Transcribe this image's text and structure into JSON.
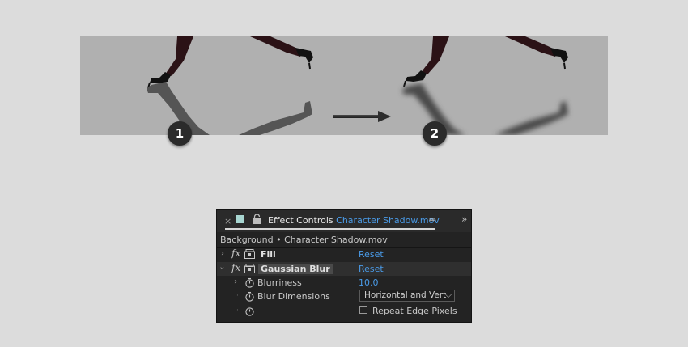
{
  "illustration": {
    "badges": [
      "1",
      "2"
    ],
    "colors": {
      "background": "#b0b0b0",
      "legs": "#2b1216",
      "boots": "#111111",
      "shadow": "#555555",
      "arrow": "#2e2e2e"
    }
  },
  "panel": {
    "tab": {
      "close_icon": "×",
      "title": "Effect Controls",
      "file": "Character Shadow.mov",
      "menu_icon": "≡",
      "more_icon": "»",
      "swatch_color": "#a8d6d1"
    },
    "breadcrumb": "Background • Character Shadow.mov",
    "effects": [
      {
        "name": "Fill",
        "fx": "fx",
        "reset": "Reset",
        "expanded": false
      },
      {
        "name": "Gaussian Blur",
        "fx": "fx",
        "reset": "Reset",
        "expanded": true
      }
    ],
    "properties": {
      "blurriness": {
        "label": "Blurriness",
        "value": "10.0"
      },
      "blur_dimensions": {
        "label": "Blur Dimensions",
        "value": "Horizontal and Vert"
      },
      "repeat_edge": {
        "label": "Repeat Edge Pixels",
        "checked": false
      }
    },
    "accent_color": "#4a9be8"
  }
}
